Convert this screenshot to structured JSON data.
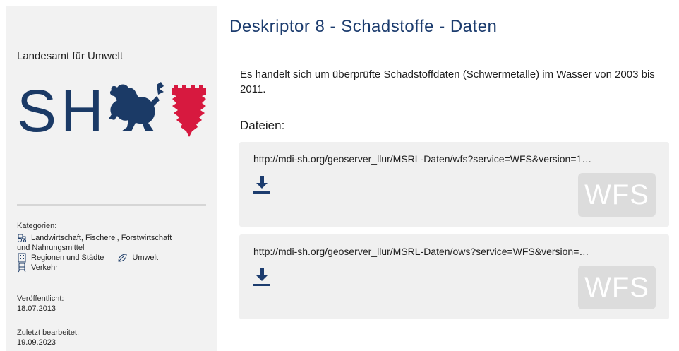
{
  "sidebar": {
    "org_name": "Landesamt für Umwelt",
    "logo_letters": "SH",
    "categories_label": "Kategorien:",
    "categories": [
      {
        "icon": "tractor-icon",
        "label": "Landwirtschaft, Fischerei, Forstwirtschaft"
      },
      {
        "icon": "",
        "label": "und Nahrungsmittel"
      },
      {
        "icon": "buildings-icon",
        "label": "Regionen und Städte"
      },
      {
        "icon": "leaf-icon",
        "label": "Umwelt"
      },
      {
        "icon": "train-icon",
        "label": "Verkehr"
      }
    ],
    "published_label": "Veröffentlicht:",
    "published_value": "18.07.2013",
    "modified_label": "Zuletzt bearbeitet:",
    "modified_value": "19.09.2023"
  },
  "main": {
    "title": "Deskriptor 8 - Schadstoffe - Daten",
    "description": "Es handelt sich um überprüfte Schadstoffdaten (Schwermetalle) im Wasser von 2003 bis 2011.",
    "files_heading": "Dateien:",
    "files": [
      {
        "url": "http://mdi-sh.org/geoserver_llur/MSRL-Daten/wfs?service=WFS&version=1…",
        "format": "WFS"
      },
      {
        "url": "http://mdi-sh.org/geoserver_llur/MSRL-Daten/ows?service=WFS&version=…",
        "format": "WFS"
      }
    ]
  },
  "colors": {
    "title_blue": "#1c3c6e",
    "logo_blue": "#1b3a66",
    "logo_red": "#d7193f",
    "sidebar_bg": "#f2f2f2",
    "card_bg": "#f0f0f0"
  }
}
